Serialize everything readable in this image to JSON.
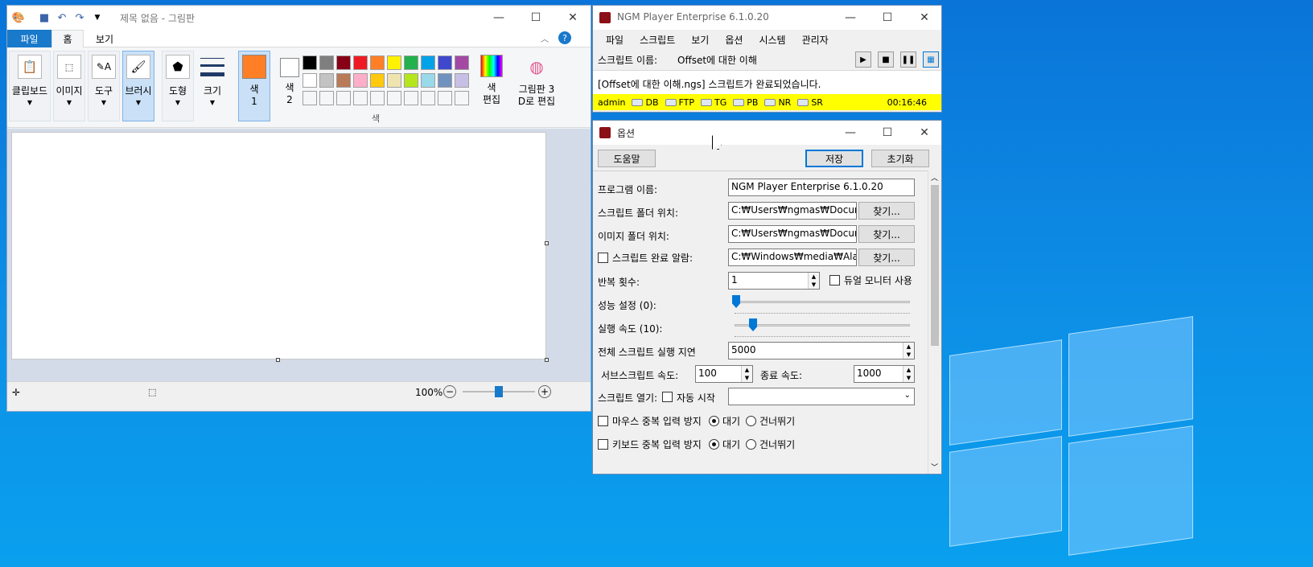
{
  "paint": {
    "title": "제목 없음 - 그림판",
    "tabs": [
      "파일",
      "홈",
      "보기"
    ],
    "groups": {
      "clipboard": "클립보드",
      "image": "이미지",
      "tools": "도구",
      "brush": "브러시",
      "shapes": "도형",
      "size": "크기",
      "color1": "색\n1",
      "color2": "색\n2",
      "edit_colors": "색\n편집",
      "paint3d": "그림판 3\nD로 편집",
      "colors_caption": "색"
    },
    "palette_colors": [
      "#000000",
      "#7f7f7f",
      "#880015",
      "#ed1c24",
      "#ff7f27",
      "#fff200",
      "#22b14c",
      "#00a2e8",
      "#3f48cc",
      "#a349a4",
      "#ffffff",
      "#c3c3c3",
      "#b97a57",
      "#ffaec9",
      "#ffc90e",
      "#efe4b0",
      "#b5e61d",
      "#99d9ea",
      "#7092be",
      "#c8bfe7"
    ],
    "color1_value": "#ff7f27",
    "color2_value": "#ffffff",
    "zoom": "100%"
  },
  "ngm": {
    "title": "NGM Player   Enterprise 6.1.0.20",
    "menu": [
      "파일",
      "스크립트",
      "보기",
      "옵션",
      "시스템",
      "관리자"
    ],
    "script_label": "스크립트 이름:",
    "script_name": "Offset에 대한 이해",
    "message": "[Offset에 대한 이해.ngs] 스크립트가 완료되었습니다.",
    "status": {
      "user": "admin",
      "flags": [
        "DB",
        "FTP",
        "TG",
        "PB",
        "NR",
        "SR"
      ],
      "time": "00:16:46"
    }
  },
  "options": {
    "title": "옵션",
    "help_btn": "도움말",
    "save_btn": "저장",
    "reset_btn": "초기화",
    "program_name_label": "프로그램 이름:",
    "program_name_value": "NGM Player   Enterprise 6.1.0.20",
    "script_folder_label": "스크립트 폴더 위치:",
    "script_folder_value": "C:₩Users₩ngmas₩Docume",
    "image_folder_label": "이미지 폴더 위치:",
    "image_folder_value": "C:₩Users₩ngmas₩Docume",
    "alarm_label": "스크립트 완료 알람:",
    "alarm_value": "C:₩Windows₩media₩Alarn",
    "browse": "찾기...",
    "repeat_label": "반복 횟수:",
    "repeat_value": "1",
    "dual_monitor": "듀얼 모니터 사용",
    "perf_label": "성능 설정 (0):",
    "speed_label": "실행 속도 (10):",
    "perf_level": 0,
    "speed_level": 10,
    "delay_label": "전체 스크립트 실행 지연",
    "delay_value": "5000",
    "sub_speed_label": "서브스크립트 속도:",
    "sub_speed_value": "100",
    "end_speed_label": "종료 속도:",
    "end_speed_value": "1000",
    "open_label": "스크립트 열기:",
    "autostart": "자동 시작",
    "mouse_dup": "마우스 중복 입력 방지",
    "kbd_dup": "키보드 중복 입력 방지",
    "wait": "대기",
    "skip": "건너뛰기"
  }
}
